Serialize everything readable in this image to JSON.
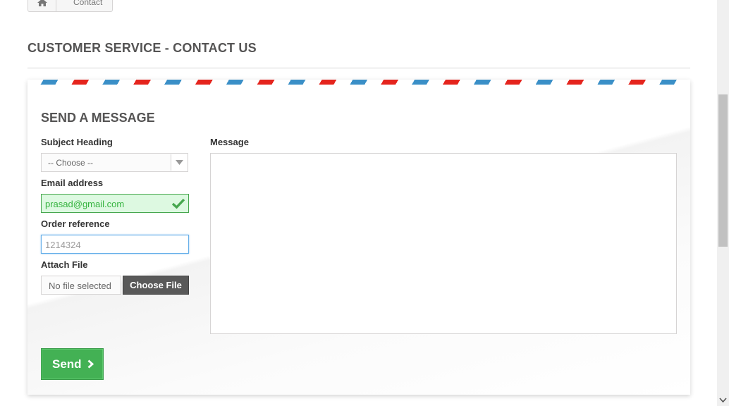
{
  "breadcrumb": {
    "current": "Contact"
  },
  "page_heading": "CUSTOMER SERVICE - CONTACT US",
  "form": {
    "title": "SEND A MESSAGE",
    "subject_label": "Subject Heading",
    "subject_value": "-- Choose --",
    "email_label": "Email address",
    "email_value": "prasad@gmail.com",
    "order_label": "Order reference",
    "order_value": "1214324",
    "attach_label": "Attach File",
    "file_status": "No file selected",
    "file_button": "Choose File",
    "message_label": "Message",
    "message_value": "",
    "send_label": "Send"
  },
  "colors": {
    "accent_green": "#43b154",
    "stripe_blue": "#3a8fc7",
    "stripe_red": "#e5241d",
    "valid_bg": "#ddf9e1"
  },
  "icons": {
    "home": "home-icon",
    "check": "check-icon",
    "send": "chevron-right-icon",
    "dropdown": "chevron-down-icon"
  }
}
